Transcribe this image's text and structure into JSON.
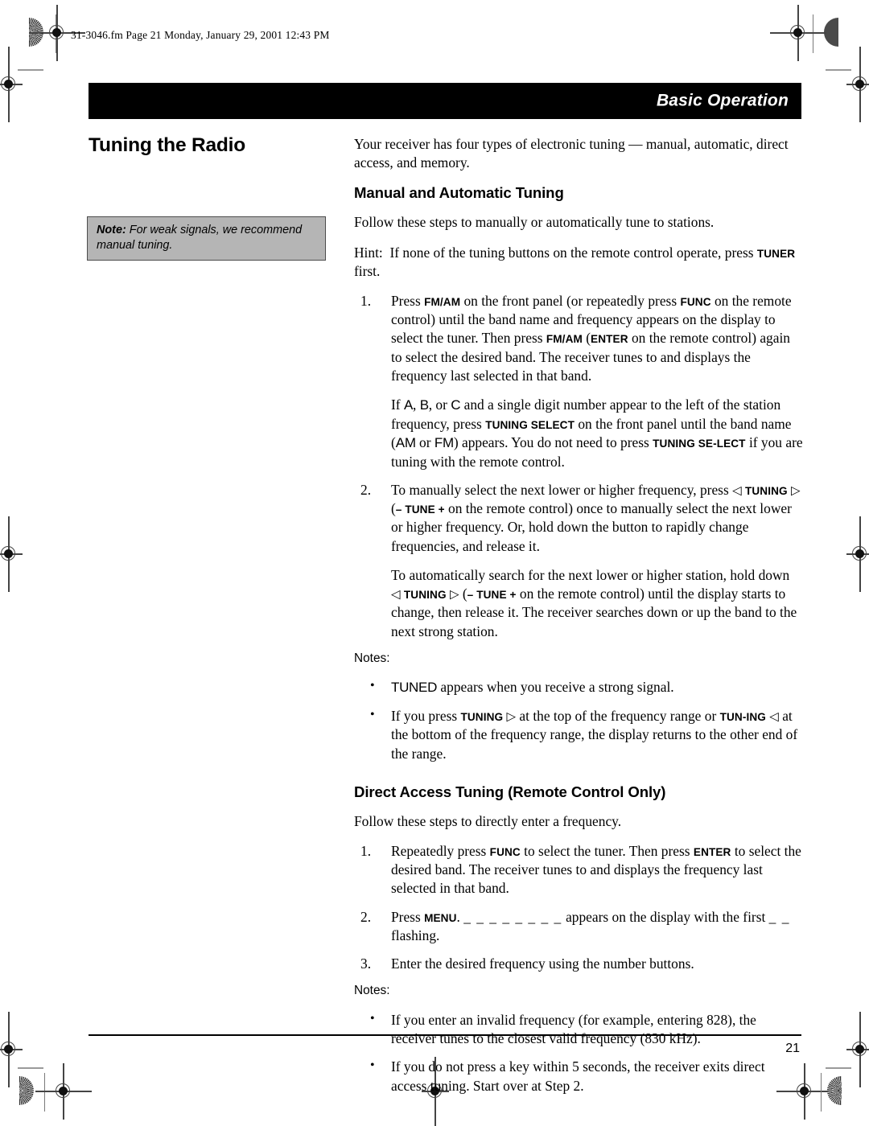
{
  "header": {
    "filestamp": "31-3046.fm  Page 21  Monday, January 29, 2001  12:43 PM"
  },
  "banner": {
    "title": "Basic Operation"
  },
  "left_column": {
    "section_title": "Tuning the Radio",
    "note": {
      "label": "Note:",
      "text": " For weak signals, we recommend manual tuning."
    }
  },
  "intro": "Your receiver has four types of electronic tuning — manual, automatic, direct access, and memory.",
  "section_manual": {
    "heading": "Manual and Automatic Tuning",
    "lead": "Follow these steps to manually or automatically tune to stations.",
    "hint": {
      "label": "Hint:",
      "part1": "If none of the tuning buttons on the remote control operate, press ",
      "button": "TUNER",
      "part2": " first."
    },
    "step1": {
      "num": "1.",
      "p1_a": "Press ",
      "p1_btn1": "FM/AM",
      "p1_b": " on the front panel (or repeatedly press ",
      "p1_btn2": "FUNC",
      "p1_c": " on the remote control) until the band name and frequency appears on the display to select the tuner. Then press ",
      "p1_btn3": "FM/AM",
      "p1_d": " (",
      "p1_btn4": "ENTER",
      "p1_e": " on the remote control) again to select the desired band. The receiver tunes to and displays the frequency last selected in that band.",
      "p2_a": "If ",
      "p2_lcd_a": "A",
      "p2_b": ", ",
      "p2_lcd_b": "B",
      "p2_c": ", or ",
      "p2_lcd_c": "C",
      "p2_d": " and a single digit number appear to the left of the station frequency, press ",
      "p2_btn1": "TUNING SELECT",
      "p2_e": " on the front panel until the band name (",
      "p2_lcd_d": "AM",
      "p2_f": " or ",
      "p2_lcd_e": "FM",
      "p2_g": ") appears. You do not need to press ",
      "p2_btn2": "TUNING SE-LECT",
      "p2_h": " if you are tuning with the remote control."
    },
    "step2": {
      "num": "2.",
      "p1_a": "To manually select the next lower or higher frequency, press ",
      "p1_tri1": "◁",
      "p1_btn1": "TUNING",
      "p1_tri2": "▷",
      "p1_b": " (",
      "p1_btn2": "– TUNE +",
      "p1_c": " on the remote control) once to manually select the next lower or higher frequency. Or, hold down the button to rapidly change frequencies, and release it.",
      "p2_a": "To automatically search for the next lower or higher station, hold down ",
      "p2_tri1": "◁",
      "p2_btn1": "TUNING",
      "p2_tri2": "▷",
      "p2_b": " (",
      "p2_btn2": "– TUNE +",
      "p2_c": " on the remote control) until the display starts to change, then release it. The receiver searches down or up the band to the next strong station."
    },
    "notes_label": "Notes:",
    "note_bullets": [
      {
        "bullet": "•",
        "lcd": "TUNED",
        "text": " appears when you receive a strong signal."
      },
      {
        "bullet": "•",
        "a": "If you press ",
        "btn1": "TUNING",
        "tri1": "▷",
        "b": " at the top of the frequency range or ",
        "btn2": "TUN-ING",
        "tri2": "◁",
        "c": " at the bottom of the frequency range, the display returns to the other end of the range."
      }
    ]
  },
  "section_direct": {
    "heading": "Direct Access Tuning (Remote Control Only)",
    "lead": "Follow these steps to directly enter a frequency.",
    "step1": {
      "num": "1.",
      "a": "Repeatedly press ",
      "btn1": "FUNC",
      "b": " to select the tuner. Then press ",
      "btn2": "ENTER",
      "c": " to select the desired band. The receiver tunes to and displays the frequency last selected in that band."
    },
    "step2": {
      "num": "2.",
      "a": "Press ",
      "btn1": "MENU",
      "b": ". ",
      "dashes": "_ _   _ _   _ _   _ _",
      "c": " appears on the display with the first ",
      "dashes2": "_ _",
      "d": " flashing."
    },
    "step3": {
      "num": "3.",
      "text": "Enter the desired frequency using the number buttons."
    },
    "notes_label": "Notes:",
    "note_bullets": [
      {
        "bullet": "•",
        "text": "If you enter an invalid frequency (for example, entering 828), the receiver tunes to the closest valid frequency (830 kHz)."
      },
      {
        "bullet": "•",
        "text": "If you do not press a key within 5 seconds, the receiver exits direct access tuning. Start over at Step 2."
      }
    ]
  },
  "footer": {
    "page_number": "21"
  }
}
